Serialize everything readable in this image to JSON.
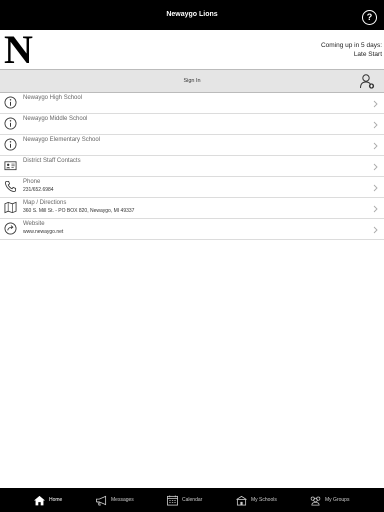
{
  "header": {
    "title": "Newaygo Lions",
    "help_icon": "?"
  },
  "banner": {
    "logo_letter": "N",
    "coming_up_line1": "Coming up in 5 days:",
    "coming_up_line2": "Late Start"
  },
  "signin": {
    "label": "Sign In",
    "icon": "user-add-icon"
  },
  "list": [
    {
      "icon": "info-icon",
      "title": "Newaygo High School",
      "subtitle": ""
    },
    {
      "icon": "info-icon",
      "title": "Newaygo Middle School",
      "subtitle": ""
    },
    {
      "icon": "info-icon",
      "title": "Newaygo Elementary School",
      "subtitle": ""
    },
    {
      "icon": "contact-card-icon",
      "title": "District Staff Contacts",
      "subtitle": ""
    },
    {
      "icon": "phone-icon",
      "title": "Phone",
      "subtitle": "231/652.6984"
    },
    {
      "icon": "map-icon",
      "title": "Map / Directions",
      "subtitle": "360 S. Mill St. - PO BOX 820, Newaygo, MI 49337"
    },
    {
      "icon": "globe-arrow-icon",
      "title": "Website",
      "subtitle": "www.newaygo.net"
    }
  ],
  "tabs": [
    {
      "icon": "home-icon",
      "label": "Home",
      "active": true
    },
    {
      "icon": "megaphone-icon",
      "label": "Messages",
      "active": false
    },
    {
      "icon": "calendar-icon",
      "label": "Calendar",
      "active": false
    },
    {
      "icon": "school-icon",
      "label": "My Schools",
      "active": false
    },
    {
      "icon": "groups-icon",
      "label": "My Groups",
      "active": false
    }
  ],
  "colors": {
    "bar": "#000000",
    "signin_bg": "#e5e5e5",
    "divider": "#dcdcdc"
  }
}
